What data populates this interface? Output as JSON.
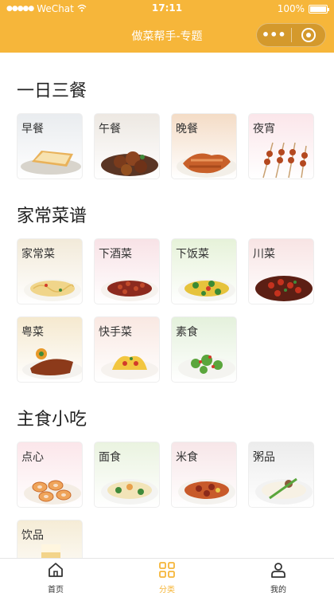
{
  "status_bar": {
    "carrier": "WeChat",
    "time": "17:11",
    "battery": "100%",
    "battery_level": 1.0
  },
  "nav": {
    "title": "做菜帮手-专题",
    "more_icon": "more-dots-icon",
    "close_icon": "capsule-close-icon"
  },
  "sections": [
    {
      "title": "一日三餐",
      "items": [
        {
          "label": "早餐",
          "tint": "#e9ecef",
          "food": "toast"
        },
        {
          "label": "午餐",
          "tint": "#ede8e2",
          "food": "braise"
        },
        {
          "label": "晚餐",
          "tint": "#f4dcc6",
          "food": "wings"
        },
        {
          "label": "夜宵",
          "tint": "#fbe6ea",
          "food": "skewer"
        }
      ]
    },
    {
      "title": "家常菜谱",
      "items": [
        {
          "label": "家常菜",
          "tint": "#f2ead9",
          "food": "noodle"
        },
        {
          "label": "下酒菜",
          "tint": "#f8e2e6",
          "food": "beans"
        },
        {
          "label": "下饭菜",
          "tint": "#e6f2d9",
          "food": "veggie"
        },
        {
          "label": "川菜",
          "tint": "#f8e4e4",
          "food": "spicy"
        },
        {
          "label": "粤菜",
          "tint": "#f5e9cf",
          "food": "roast"
        },
        {
          "label": "快手菜",
          "tint": "#f9e8e2",
          "food": "egg"
        },
        {
          "label": "素食",
          "tint": "#e4f1dc",
          "food": "salad"
        }
      ]
    },
    {
      "title": "主食小吃",
      "items": [
        {
          "label": "点心",
          "tint": "#fbe6ea",
          "food": "dessert"
        },
        {
          "label": "面食",
          "tint": "#eaf3e0",
          "food": "noodle-soup"
        },
        {
          "label": "米食",
          "tint": "#f7e6e8",
          "food": "rice"
        },
        {
          "label": "粥品",
          "tint": "#ececec",
          "food": "porridge"
        },
        {
          "label": "饮品",
          "tint": "#f5ecd6",
          "food": "drink"
        }
      ]
    }
  ],
  "tabbar": [
    {
      "label": "首页",
      "icon": "home-icon",
      "active": false
    },
    {
      "label": "分类",
      "icon": "category-grid-icon",
      "active": true
    },
    {
      "label": "我的",
      "icon": "profile-icon",
      "active": false
    }
  ],
  "colors": {
    "accent": "#f6b63a",
    "tab_active": "#f6b63a",
    "text": "#222222"
  }
}
